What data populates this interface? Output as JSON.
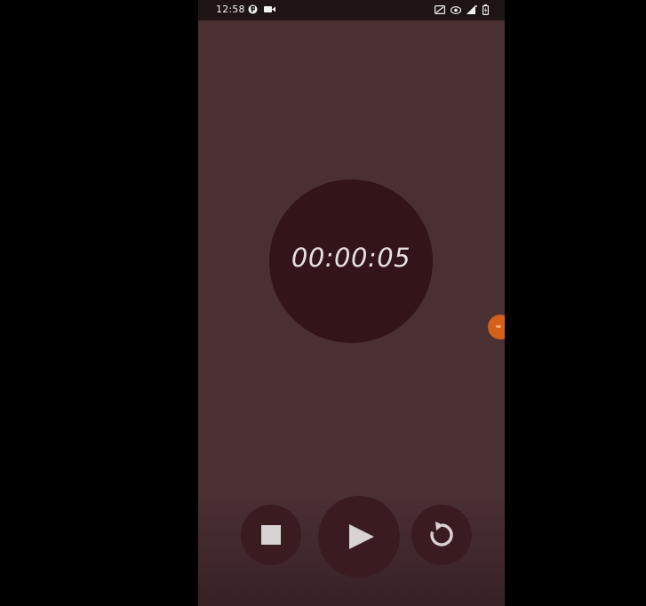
{
  "status_bar": {
    "time": "12:58",
    "left_icons": [
      "app-notification-icon",
      "video-camera-icon"
    ],
    "right_icons": [
      "cast-icon",
      "eye-icon",
      "signal-icon",
      "battery-icon"
    ]
  },
  "stopwatch": {
    "elapsed": "00:00:05"
  },
  "controls": {
    "stop": {
      "icon": "stop-icon"
    },
    "play": {
      "icon": "play-icon"
    },
    "reset": {
      "icon": "reset-icon"
    }
  },
  "floating_handle": {
    "icon": "floating-bubble-icon"
  },
  "colors": {
    "background": "#4a2f33",
    "circle": "#331418",
    "button": "#3a1c20",
    "text": "#e6dfe0",
    "accent": "#d3611c",
    "status_bar": "#1e1416"
  }
}
